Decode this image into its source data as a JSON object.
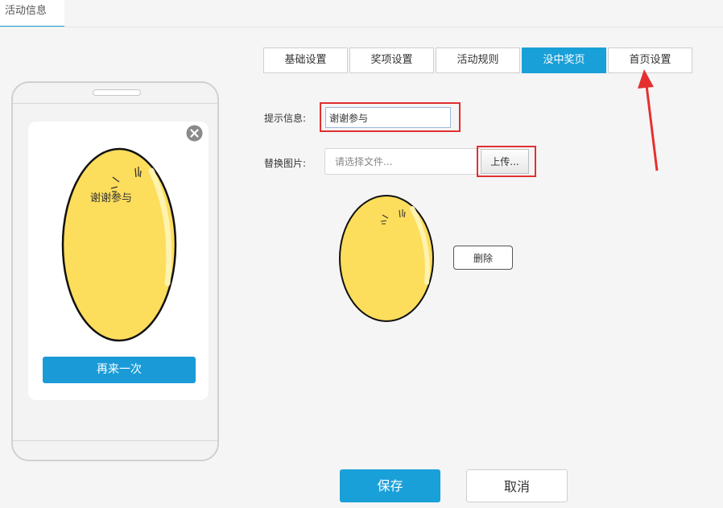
{
  "top_tab": {
    "label": "活动信息"
  },
  "phone_preview": {
    "egg_text": "谢谢参与",
    "retry_label": "再来一次",
    "egg_color": "#fddd5c"
  },
  "tabs": [
    {
      "label": "基础设置",
      "active": false
    },
    {
      "label": "奖项设置",
      "active": false
    },
    {
      "label": "活动规则",
      "active": false
    },
    {
      "label": "没中奖页",
      "active": true
    },
    {
      "label": "首页设置",
      "active": false
    }
  ],
  "form": {
    "hint_label": "提示信息:",
    "hint_value": "谢谢参与",
    "image_label": "替换图片:",
    "file_placeholder": "请选择文件...",
    "upload_label": "上传...",
    "delete_label": "删除"
  },
  "actions": {
    "save_label": "保存",
    "cancel_label": "取消"
  },
  "colors": {
    "accent": "#1aa0d8",
    "highlight": "#e03030"
  }
}
